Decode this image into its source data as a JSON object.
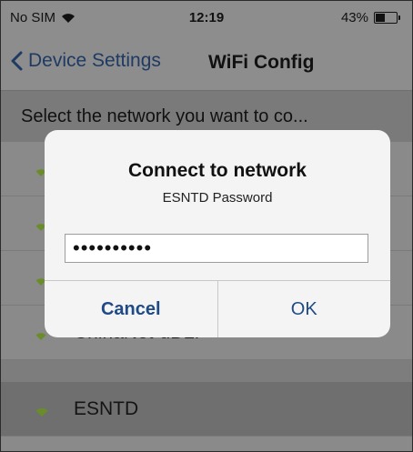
{
  "status_bar": {
    "carrier": "No SIM",
    "time": "12:19",
    "battery": "43%",
    "battery_level_percent": 43
  },
  "nav": {
    "back_label": "Device Settings",
    "title": "WiFi Config"
  },
  "section_header": "Select the network you want to co...",
  "networks": [
    {
      "name": ""
    },
    {
      "name": ""
    },
    {
      "name": ""
    },
    {
      "name": "ChinaNet-uD2i"
    },
    {
      "name": "ESNTD"
    }
  ],
  "dialog": {
    "title": "Connect to network",
    "message": "ESNTD Password",
    "password_value": "••••••••••",
    "cancel_label": "Cancel",
    "ok_label": "OK"
  },
  "colors": {
    "accent": "#1f4a86",
    "wifi_icon": "#6a8c2a"
  }
}
